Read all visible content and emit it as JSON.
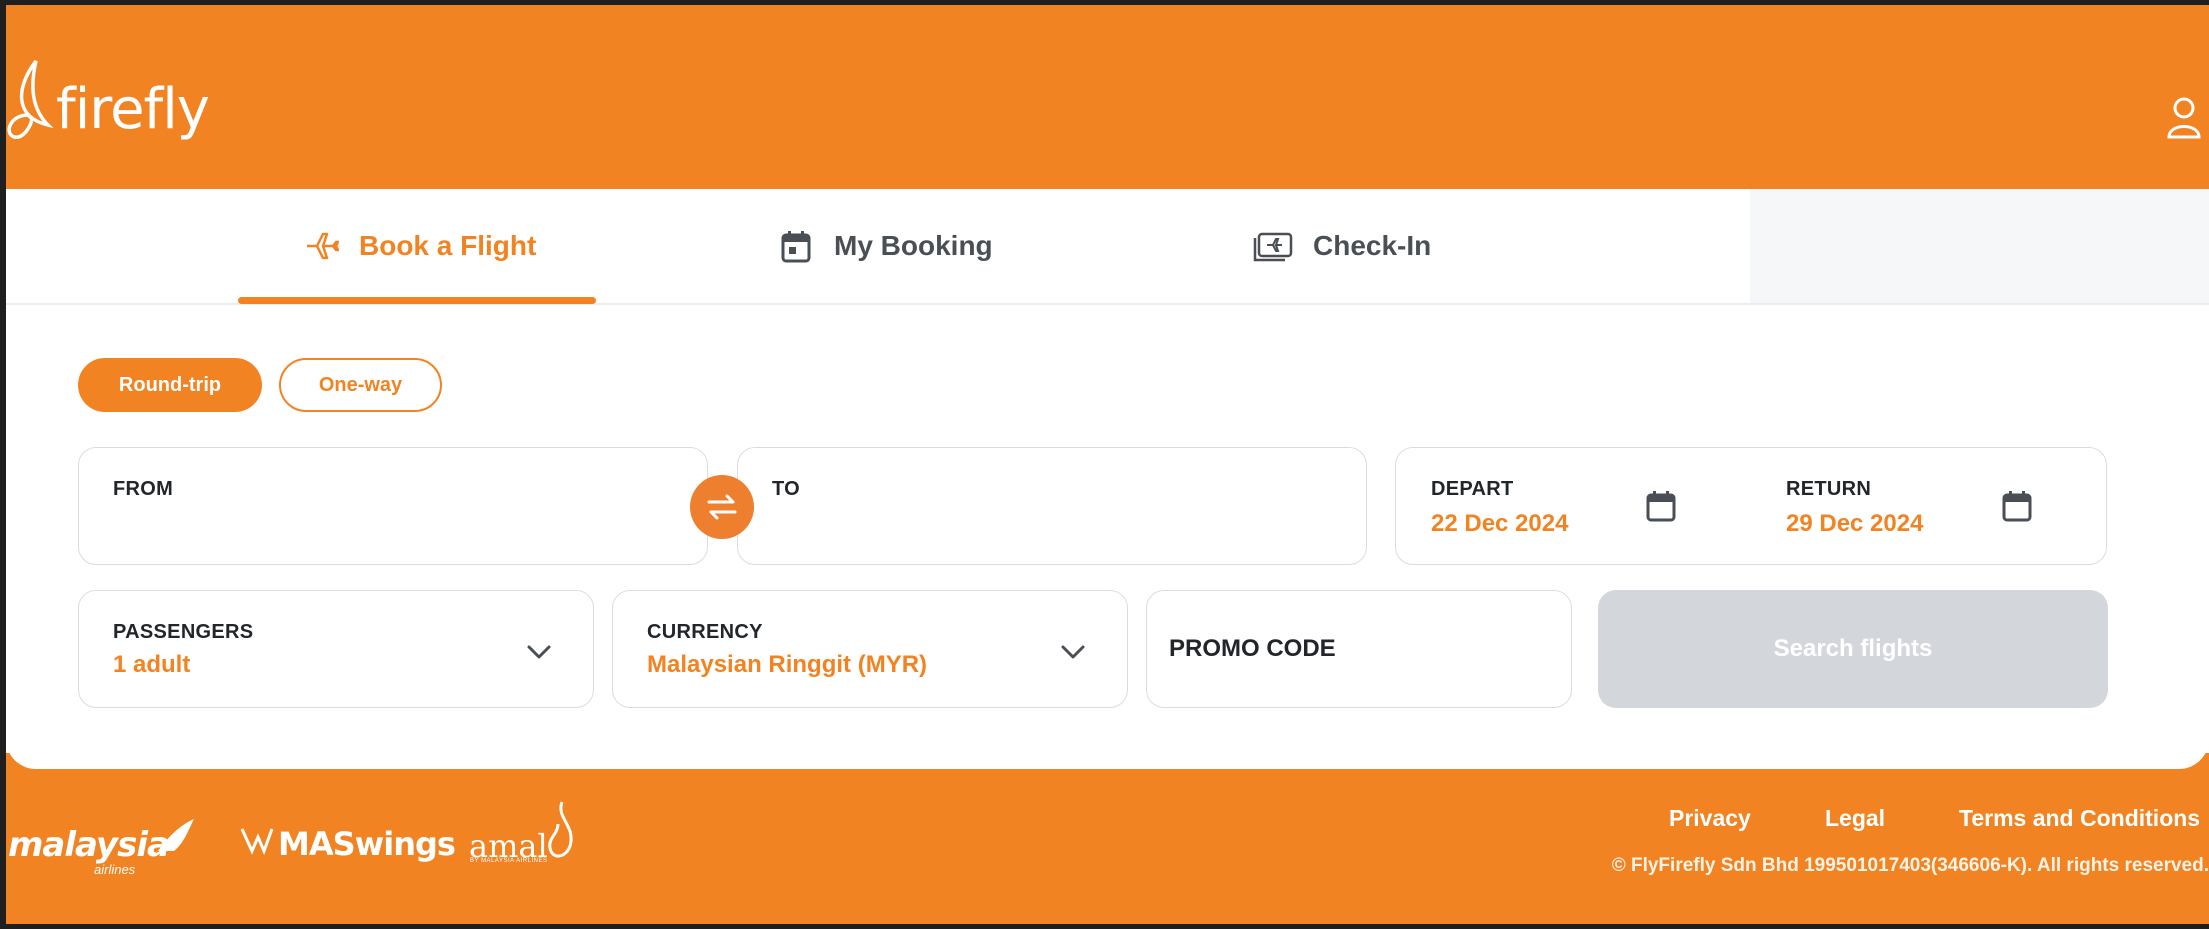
{
  "brand": {
    "name": "firefly",
    "accent": "#f28322"
  },
  "header": {
    "user_icon": "user-icon"
  },
  "tabs": [
    {
      "label": "Book a Flight",
      "icon": "plane-icon",
      "active": true
    },
    {
      "label": "My Booking",
      "icon": "calendar-icon",
      "active": false
    },
    {
      "label": "Check-In",
      "icon": "ticket-icon",
      "active": false
    }
  ],
  "trip_type": {
    "options": [
      "Round-trip",
      "One-way"
    ],
    "selected": "Round-trip"
  },
  "search_form": {
    "from_label": "FROM",
    "from_value": "",
    "to_label": "TO",
    "to_value": "",
    "depart_label": "DEPART",
    "depart_value": "22 Dec 2024",
    "return_label": "RETURN",
    "return_value": "29 Dec 2024",
    "passengers_label": "PASSENGERS",
    "passengers_value": "1 adult",
    "currency_label": "CURRENCY",
    "currency_value": "Malaysian Ringgit (MYR)",
    "promo_placeholder": "PROMO CODE",
    "search_label": "Search flights"
  },
  "footer": {
    "partners": [
      "malaysia",
      "MASwings",
      "amal"
    ],
    "partner_subs": [
      "airlines",
      "BY MALAYSIA AIRLINES"
    ],
    "links": [
      "Privacy",
      "Legal",
      "Terms and Conditions"
    ],
    "copyright": "© FlyFirefly Sdn Bhd 199501017403(346606-K). All rights reserved."
  }
}
